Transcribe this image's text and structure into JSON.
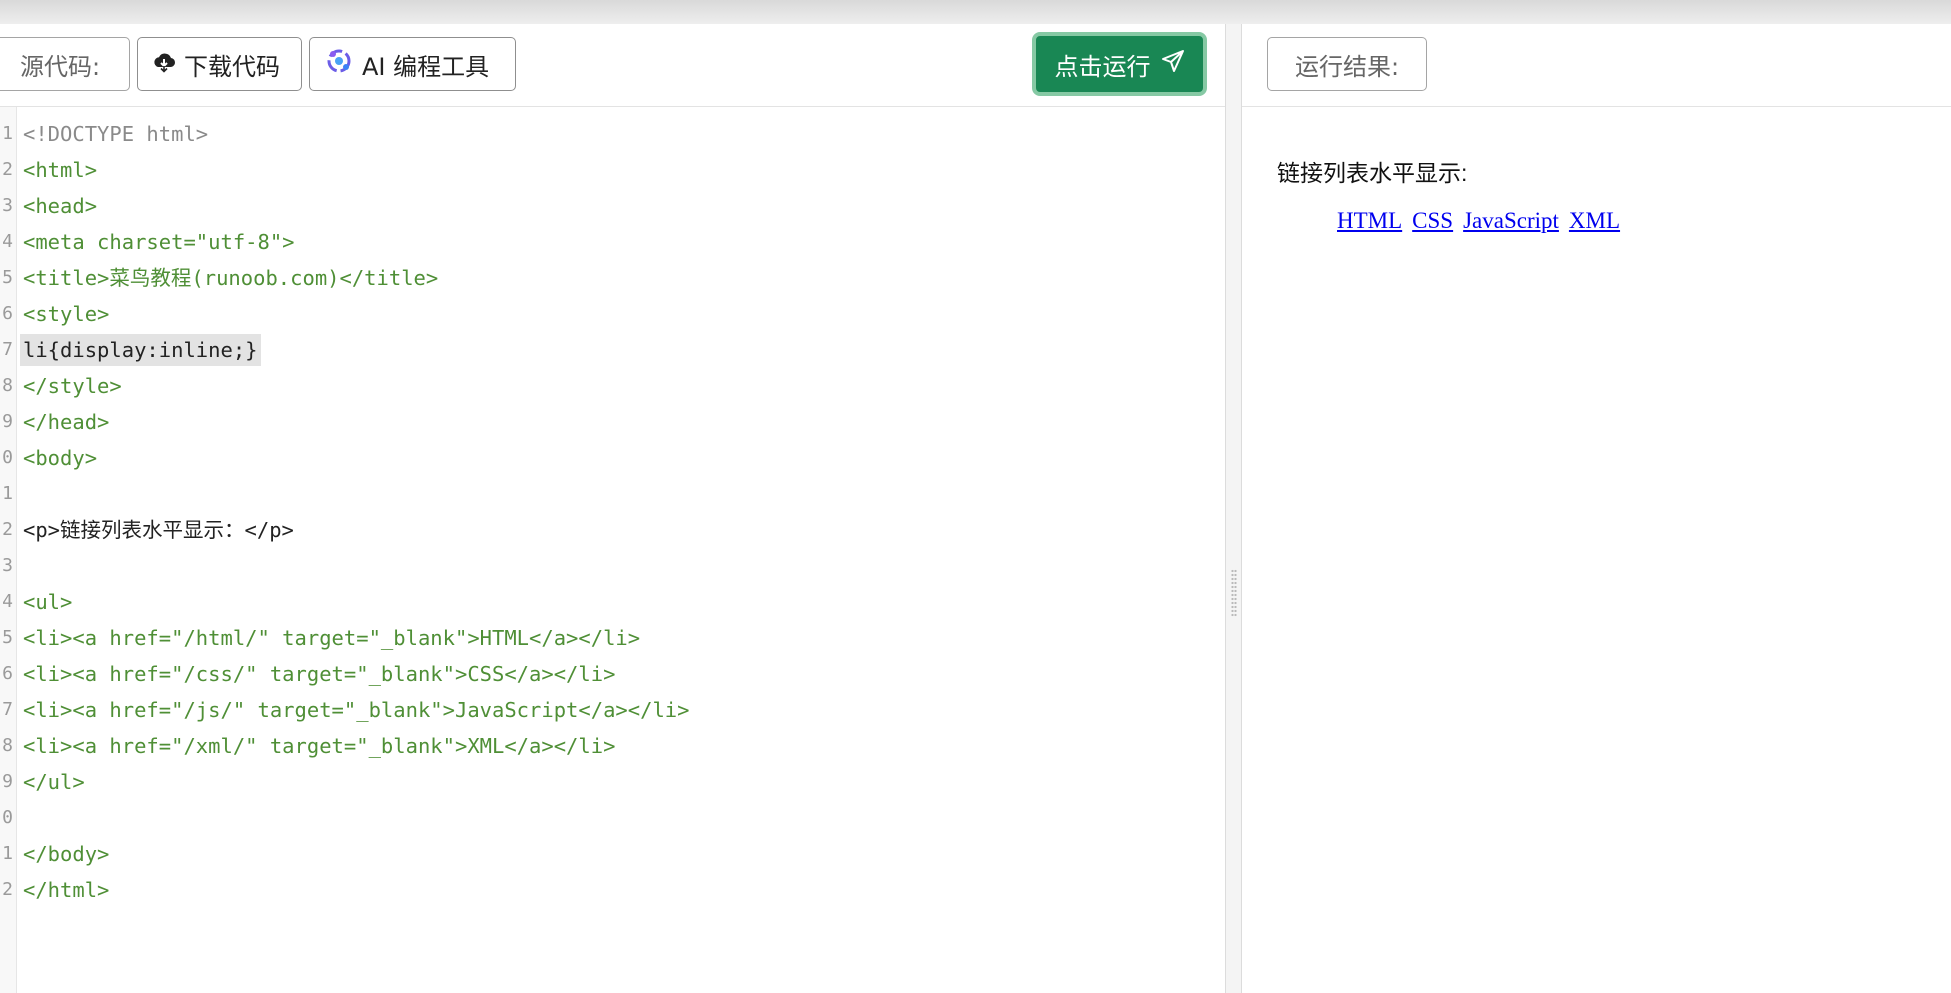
{
  "left_toolbar": {
    "source_label": "源代码:",
    "download_label": "下载代码",
    "ai_label": "AI 编程工具",
    "run_label": "点击运行"
  },
  "right_toolbar": {
    "result_label": "运行结果:"
  },
  "editor": {
    "line_numbers": [
      "1",
      "2",
      "3",
      "4",
      "5",
      "6",
      "7",
      "8",
      "9",
      "0",
      "1",
      "2",
      "3",
      "4",
      "5",
      "6",
      "7",
      "8",
      "9",
      "0",
      "1",
      "2"
    ],
    "lines": [
      "<!DOCTYPE html>",
      "<html>",
      "<head>",
      "<meta charset=\"utf-8\">",
      "<title>菜鸟教程(runoob.com)</title>",
      "<style>",
      "li{display:inline;}",
      "</style>",
      "</head>",
      "<body>",
      "",
      "<p>链接列表水平显示：</p>",
      "",
      "<ul>",
      "<li><a href=\"/html/\" target=\"_blank\">HTML</a></li>",
      "<li><a href=\"/css/\" target=\"_blank\">CSS</a></li>",
      "<li><a href=\"/js/\" target=\"_blank\">JavaScript</a></li>",
      "<li><a href=\"/xml/\" target=\"_blank\">XML</a></li>",
      "</ul>",
      "",
      "</body>",
      "</html>"
    ]
  },
  "result": {
    "paragraph": "链接列表水平显示:",
    "links": [
      "HTML",
      "CSS",
      "JavaScript",
      "XML"
    ]
  }
}
